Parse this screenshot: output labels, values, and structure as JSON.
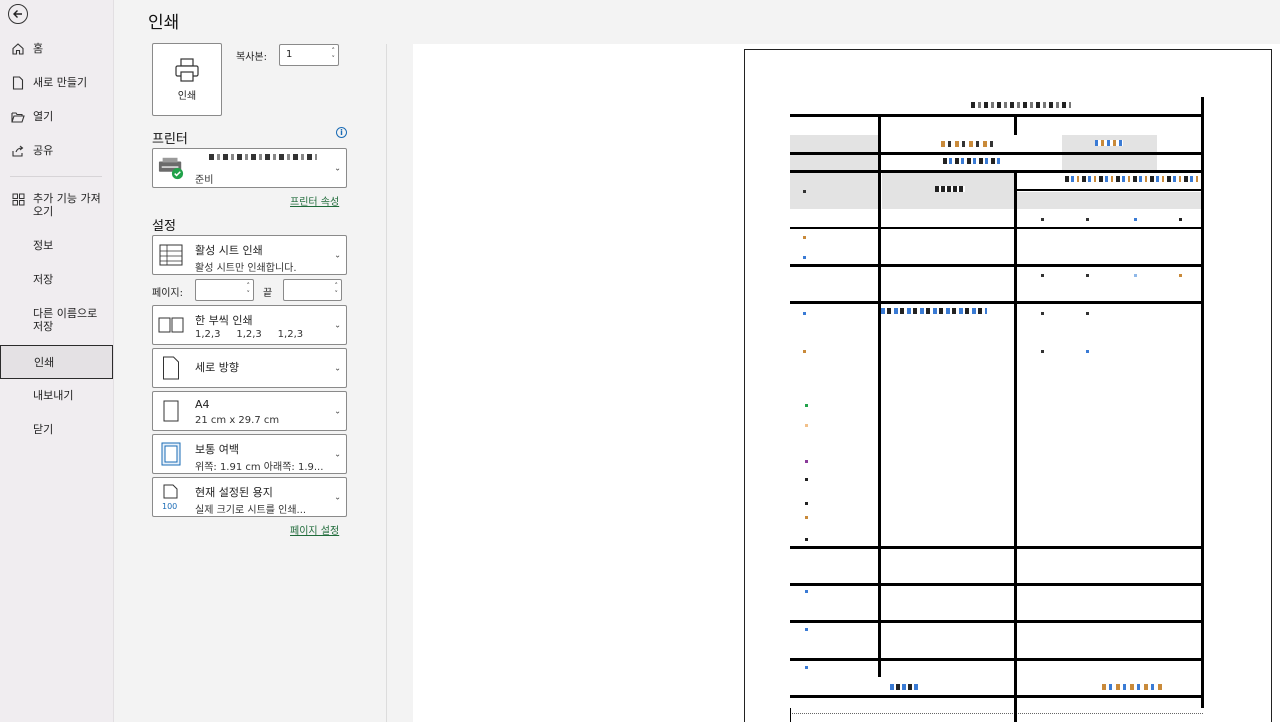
{
  "nav": {
    "items": [
      {
        "label": "홈"
      },
      {
        "label": "새로 만들기"
      },
      {
        "label": "열기"
      },
      {
        "label": "공유"
      },
      {
        "label": "추가 기능 가져오기"
      },
      {
        "label": "정보"
      },
      {
        "label": "저장"
      },
      {
        "label": "다른 이름으로 저장"
      },
      {
        "label": "인쇄"
      },
      {
        "label": "내보내기"
      },
      {
        "label": "닫기"
      }
    ],
    "active": "인쇄"
  },
  "page_title": "인쇄",
  "print_button": {
    "label": "인쇄"
  },
  "copies": {
    "label": "복사본:",
    "value": "1"
  },
  "printer": {
    "heading": "프린터",
    "status": "준비",
    "properties_link": "프린터 속성"
  },
  "settings": {
    "heading": "설정",
    "what": {
      "title": "활성 시트 인쇄",
      "subtitle": "활성 시트만 인쇄합니다."
    },
    "pages": {
      "label": "페이지:",
      "to_label": "끝",
      "from": "",
      "to": ""
    },
    "collate": {
      "title": "한 부씩 인쇄",
      "subtitle": "1,2,3     1,2,3     1,2,3"
    },
    "orientation": {
      "title": "세로 방향"
    },
    "paper": {
      "title": "A4",
      "subtitle": "21 cm x 29.7 cm"
    },
    "margins": {
      "title": "보통 여백",
      "subtitle": "위쪽: 1.91 cm 아래쪽: 1.9..."
    },
    "scaling": {
      "title": "현재 설정된 용지",
      "subtitle": "실제 크기로 시트를 인쇄...",
      "icon_text": "100"
    },
    "page_setup_link": "페이지 설정"
  },
  "colors": {
    "accent_green": "#1f6b3a",
    "info_blue": "#1a6bb5",
    "status_green": "#21a24a"
  }
}
